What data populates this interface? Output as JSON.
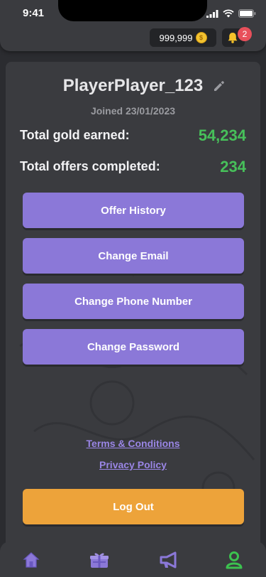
{
  "status_bar": {
    "time": "9:41"
  },
  "header": {
    "coins": "999,999",
    "coin_symbol": "$",
    "notifications": "2"
  },
  "profile": {
    "username": "PlayerPlayer_123",
    "joined": "Joined 23/01/2023",
    "gold_label": "Total gold earned:",
    "gold_value": "54,234",
    "offers_label": "Total offers completed:",
    "offers_value": "234"
  },
  "actions": {
    "offer_history": "Offer History",
    "change_email": "Change Email",
    "change_phone": "Change Phone Number",
    "change_password": "Change Password"
  },
  "links": {
    "terms": "Terms & Conditions",
    "privacy": "Privacy Policy"
  },
  "logout": "Log Out",
  "colors": {
    "accent": "#8b78d8",
    "success": "#47c05a",
    "logout": "#eda33a",
    "active_nav": "#3cc24f"
  },
  "nav": [
    "home-icon",
    "gift-icon",
    "megaphone-icon",
    "profile-icon"
  ]
}
